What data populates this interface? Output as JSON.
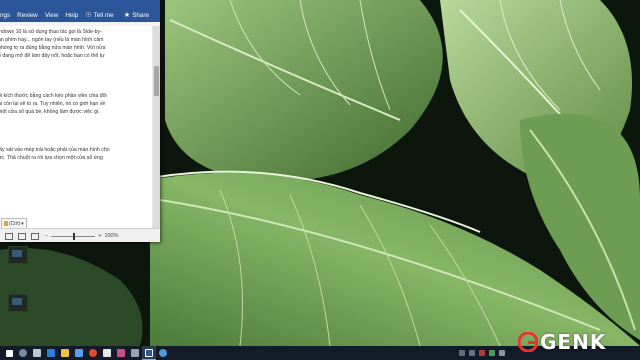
{
  "word_window": {
    "ribbon_tabs": [
      "ngs",
      "Review",
      "View",
      "Help",
      "Tell me",
      "Share"
    ],
    "document_lines": [
      "indows 10 là sử dụng thao tác gọi là Side-by-",
      "ận phím hay... ngón tay (nếu là màn hình cảm",
      "phóng to ra đúng bằng nửa màn hình. Với nửa",
      "ổ đang mở để làm đầy nốt, hoặc bạn có thể tự",
      "",
      "",
      "ổi kích thước bằng cách kéo phần viền chia đôi",
      "ài còn lại sẽ to ra. Tuy nhiên, nó có giới hạn về",
      "một cửa sổ quá bé, không làm được việc gì.",
      "",
      "",
      "lấy sát vào mép trái hoặc phải của màn hình cho",
      "ực. Thả chuột ra rồi lựa chọn một cửa sổ ứng"
    ],
    "paste_options_label": "(Ctrl)",
    "zoom_minus": "−",
    "zoom_plus": "+",
    "zoom_level": "100%",
    "zoom_fraction": 0.5
  },
  "watermark": {
    "text": "GENK",
    "color": "#e8322d"
  },
  "icons": {
    "tell_me": "lightbulb-icon",
    "share": "share-icon",
    "paste": "clipboard-icon",
    "status": [
      "read-mode-icon",
      "print-layout-icon",
      "web-layout-icon"
    ],
    "taskbar_apps": [
      "start-icon",
      "search-icon",
      "task-view-icon",
      "edge-icon",
      "file-explorer-icon",
      "store-icon",
      "chrome-icon",
      "mail-icon",
      "photos-icon",
      "settings-icon",
      "word-icon",
      "cortana-icon"
    ],
    "tray": [
      "network-icon",
      "volume-icon",
      "battery-icon",
      "antivirus-icon",
      "notification-icon"
    ]
  }
}
